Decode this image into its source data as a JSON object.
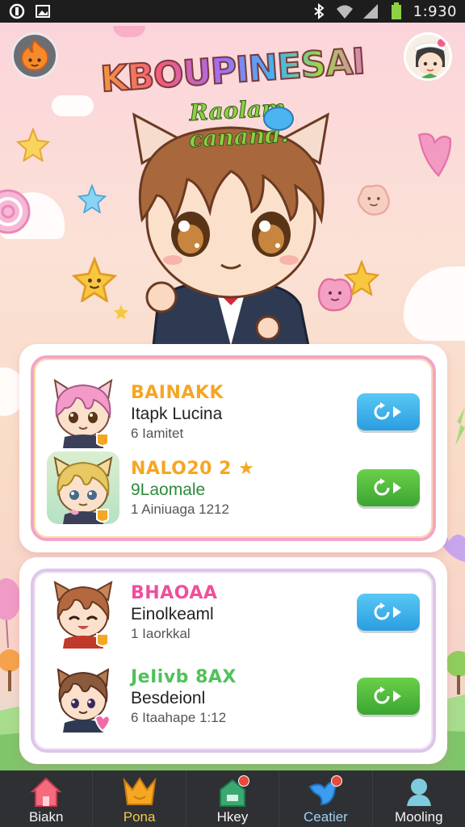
{
  "status_bar": {
    "time": "1:930",
    "left_icons": [
      "circle-app-icon",
      "image-icon"
    ],
    "right_icons": [
      "bluetooth-icon",
      "wifi-icon",
      "signal-icon",
      "battery-icon"
    ]
  },
  "header": {
    "title": "KBOUPINESAI",
    "subtitle": "Raolam canand."
  },
  "cards": [
    {
      "entries": [
        {
          "tag": "BAINAKK",
          "name": "Itapk Lucina",
          "meta": "6 Iamitet",
          "tag_color": "#f5a623",
          "hair": "#f49ac9",
          "button": "blue",
          "badge": "#f5a623"
        },
        {
          "tag": "NALO20 2 ★",
          "name": "9Laomale",
          "meta": "1 Ainiuaga 1212",
          "tag_color": "#f5a623",
          "hair": "#e7c862",
          "button": "green",
          "badge": "#f5a623"
        }
      ]
    },
    {
      "entries": [
        {
          "tag": "BHAOAA",
          "name": "Einolkeaml",
          "meta": "1 Iaorkkal",
          "tag_color": "#ef4f9a",
          "hair": "#b4683d",
          "button": "blue",
          "badge": "#f5a623"
        },
        {
          "tag": "JeIivb 8AX",
          "name": "Besdeionl",
          "meta": "6 Itaahape 1:12",
          "tag_color": "#4fc25a",
          "hair": "#8b5a3c",
          "button": "green",
          "badge": "#f06aa8"
        }
      ]
    }
  ],
  "bottom_nav": [
    {
      "label": "Biakn",
      "icon": "home-icon",
      "color": "#f56a7d",
      "badge": false,
      "active": false
    },
    {
      "label": "Pona",
      "icon": "crown-fox-icon",
      "color": "#f5a623",
      "badge": false,
      "active": true
    },
    {
      "label": "Hkey",
      "icon": "shop-house-icon",
      "color": "#3aa870",
      "badge": true,
      "active": false
    },
    {
      "label": "Ceatier",
      "icon": "bird-icon",
      "color": "#3b9cf0",
      "badge": true,
      "active": false
    },
    {
      "label": "Mooling",
      "icon": "character-icon",
      "color": "#7ecbe0",
      "badge": false,
      "active": false
    }
  ]
}
